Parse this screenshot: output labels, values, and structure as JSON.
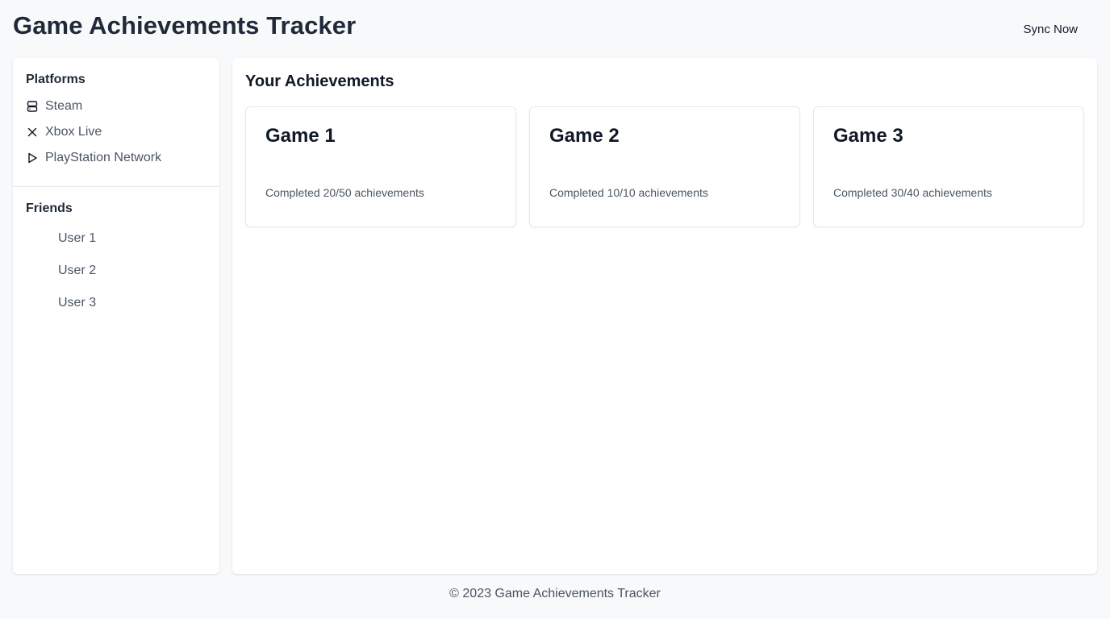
{
  "header": {
    "title": "Game Achievements Tracker",
    "sync_label": "Sync Now"
  },
  "sidebar": {
    "platforms_heading": "Platforms",
    "platforms": [
      {
        "label": "Steam",
        "icon": "steam-icon"
      },
      {
        "label": "Xbox Live",
        "icon": "xbox-icon"
      },
      {
        "label": "PlayStation Network",
        "icon": "playstation-icon"
      }
    ],
    "friends_heading": "Friends",
    "friends": [
      {
        "label": "User 1"
      },
      {
        "label": "User 2"
      },
      {
        "label": "User 3"
      }
    ]
  },
  "main": {
    "title": "Your Achievements",
    "games": [
      {
        "title": "Game 1",
        "progress": "Completed 20/50 achievements"
      },
      {
        "title": "Game 2",
        "progress": "Completed 10/10 achievements"
      },
      {
        "title": "Game 3",
        "progress": "Completed 30/40 achievements"
      }
    ]
  },
  "footer": {
    "text": "© 2023 Game Achievements Tracker"
  }
}
